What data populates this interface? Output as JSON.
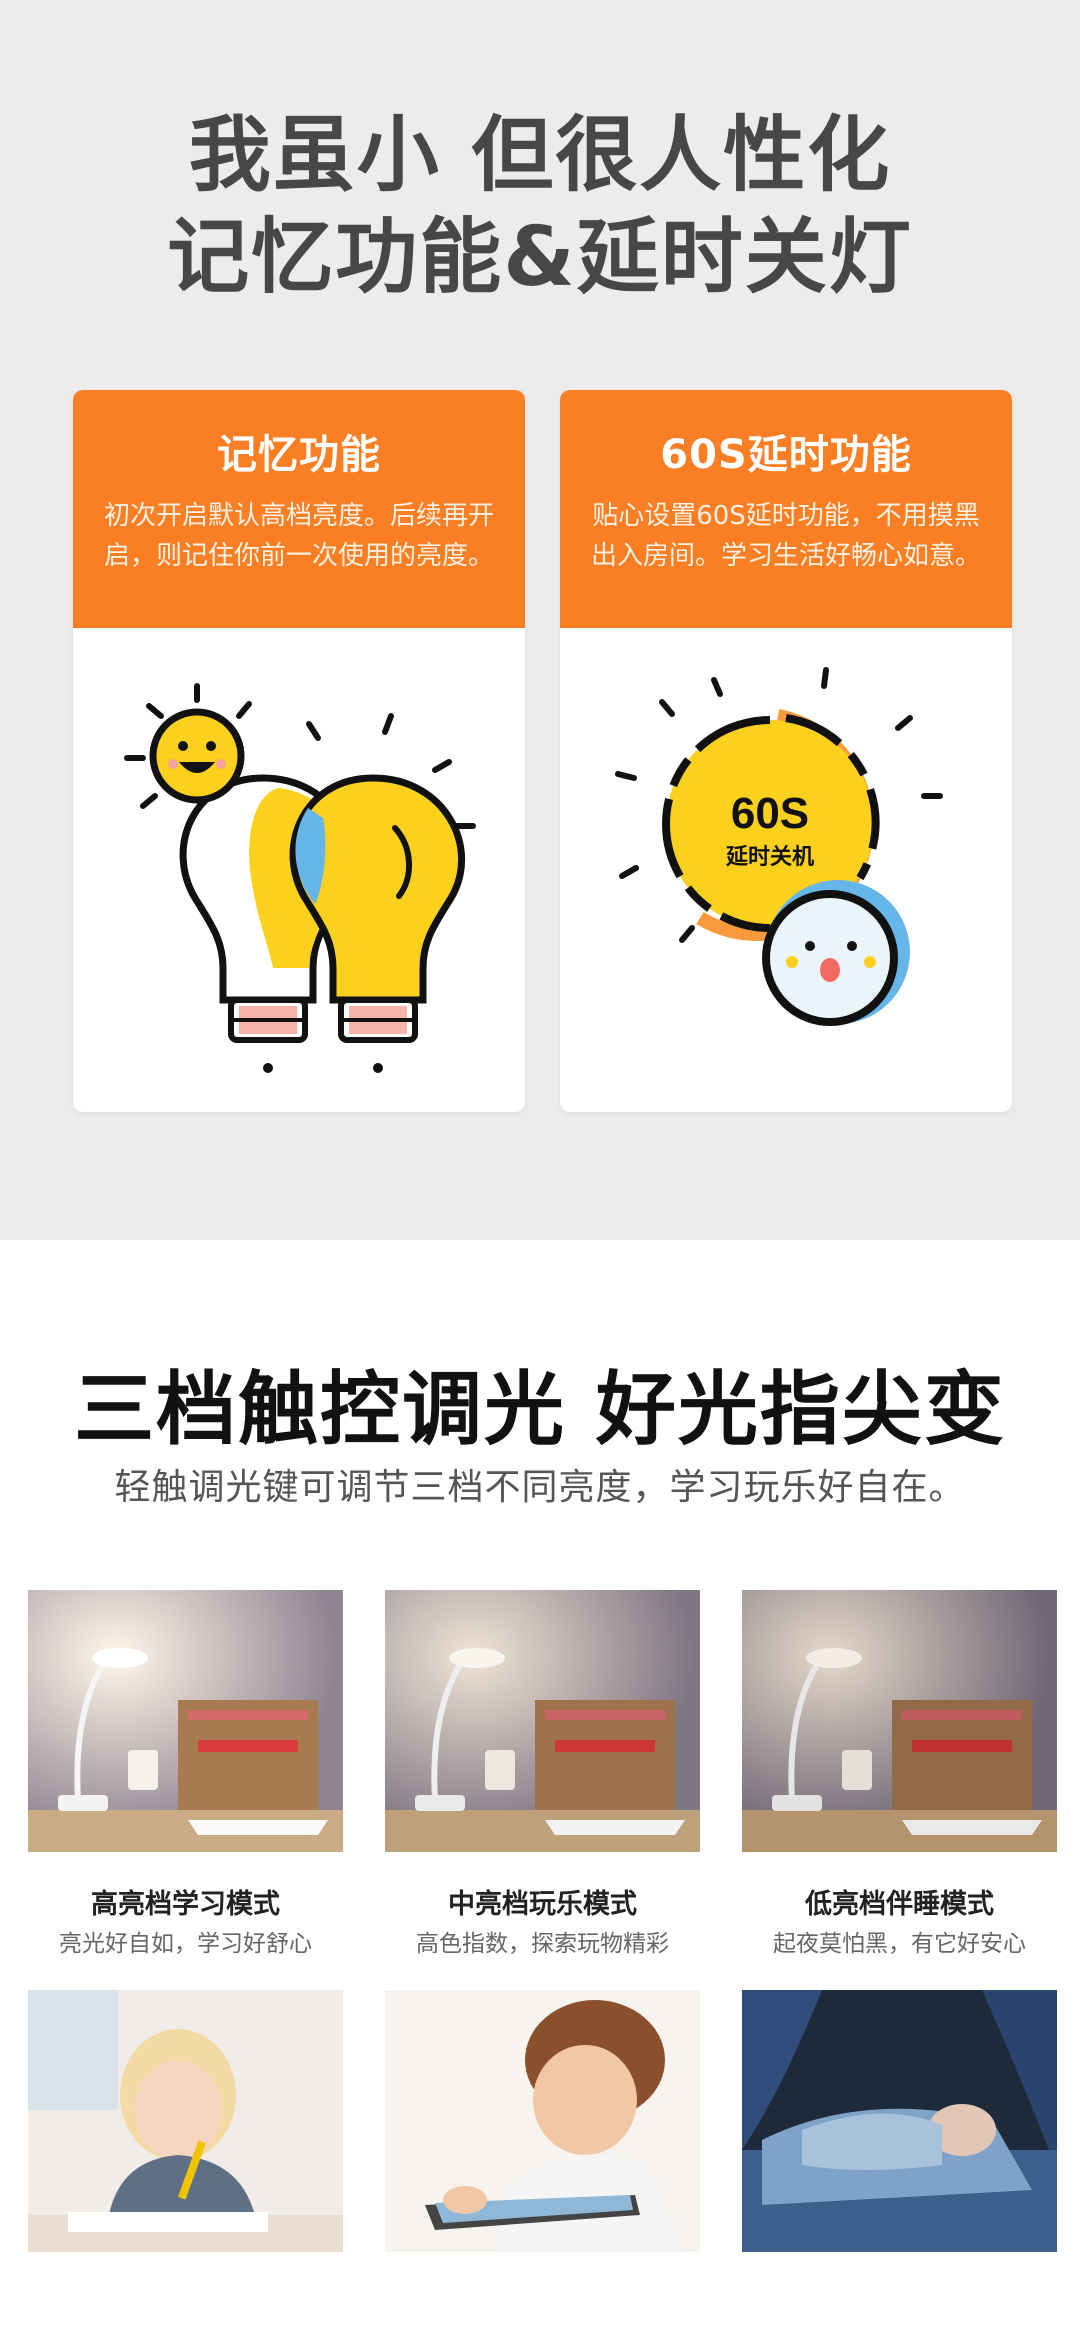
{
  "hero": {
    "line1": "我虽小 但很人性化",
    "line2": "记忆功能&延时关灯"
  },
  "features": [
    {
      "title": "记忆功能",
      "desc": "初次开启默认高档亮度。后续再开启，则记住你前一次使用的亮度。",
      "illustration": "two-light-bulbs-with-smiling-sun-icon"
    },
    {
      "title": "60S延时功能",
      "desc": "贴心设置60S延时功能，不用摸黑出入房间。学习生活好畅心如意。",
      "illustration": "timer-sun-with-face-icon",
      "badge_main": "60S",
      "badge_sub": "延时关机"
    }
  ],
  "section2": {
    "title": "三档触控调光  好光指尖变",
    "subtitle": "轻触调光键可调节三档不同亮度，学习玩乐好自在。"
  },
  "modes": [
    {
      "title": "高亮档学习模式",
      "sub": "亮光好自如，学习好舒心"
    },
    {
      "title": "中亮档玩乐模式",
      "sub": "高色指数，探索玩物精彩"
    },
    {
      "title": "低亮档伴睡模式",
      "sub": "起夜莫怕黑，有它好安心"
    }
  ],
  "colors": {
    "accent_orange": "#fa7f24",
    "bulb_yellow": "#fbd11d",
    "soft_blue": "#66b6ea"
  }
}
